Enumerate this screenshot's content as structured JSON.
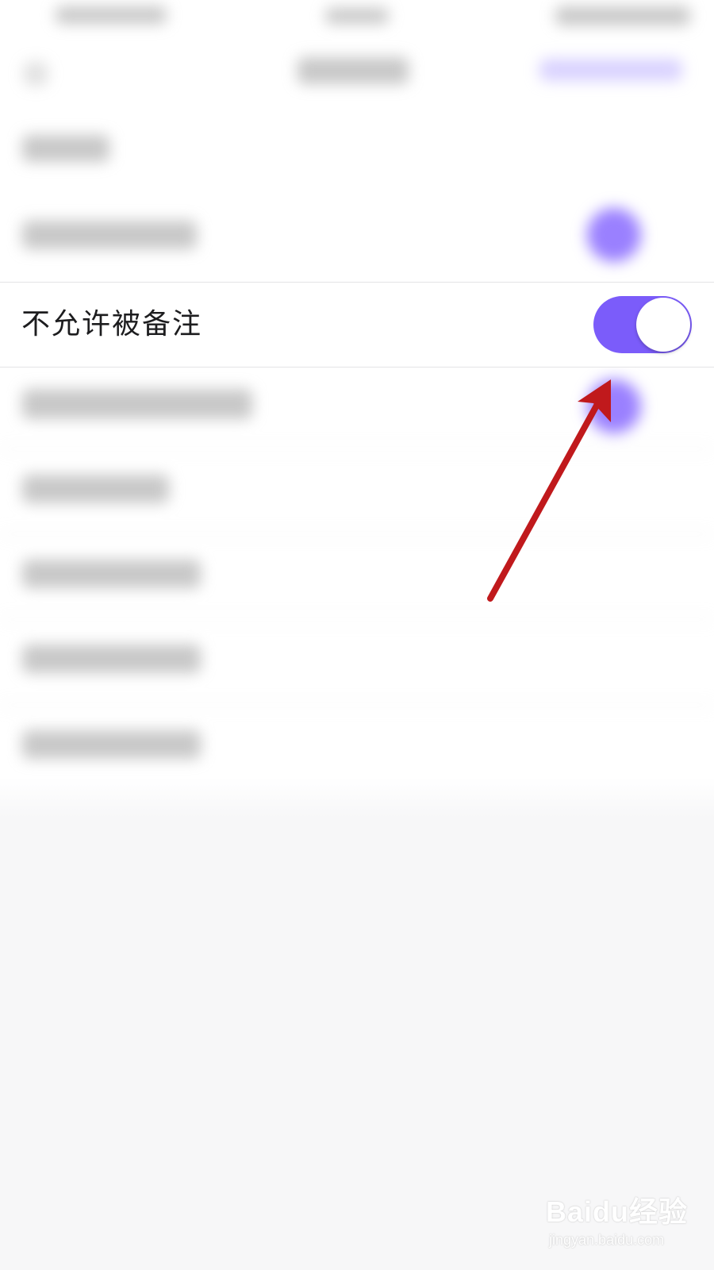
{
  "setting_row": {
    "label": "不允许被备注",
    "toggle_on": true
  },
  "colors": {
    "accent": "#7b5cfa",
    "annotation_arrow": "#c0191c"
  },
  "watermark": {
    "logo_text": "Baidu经验",
    "url_text": "jingyan.baidu.com"
  }
}
